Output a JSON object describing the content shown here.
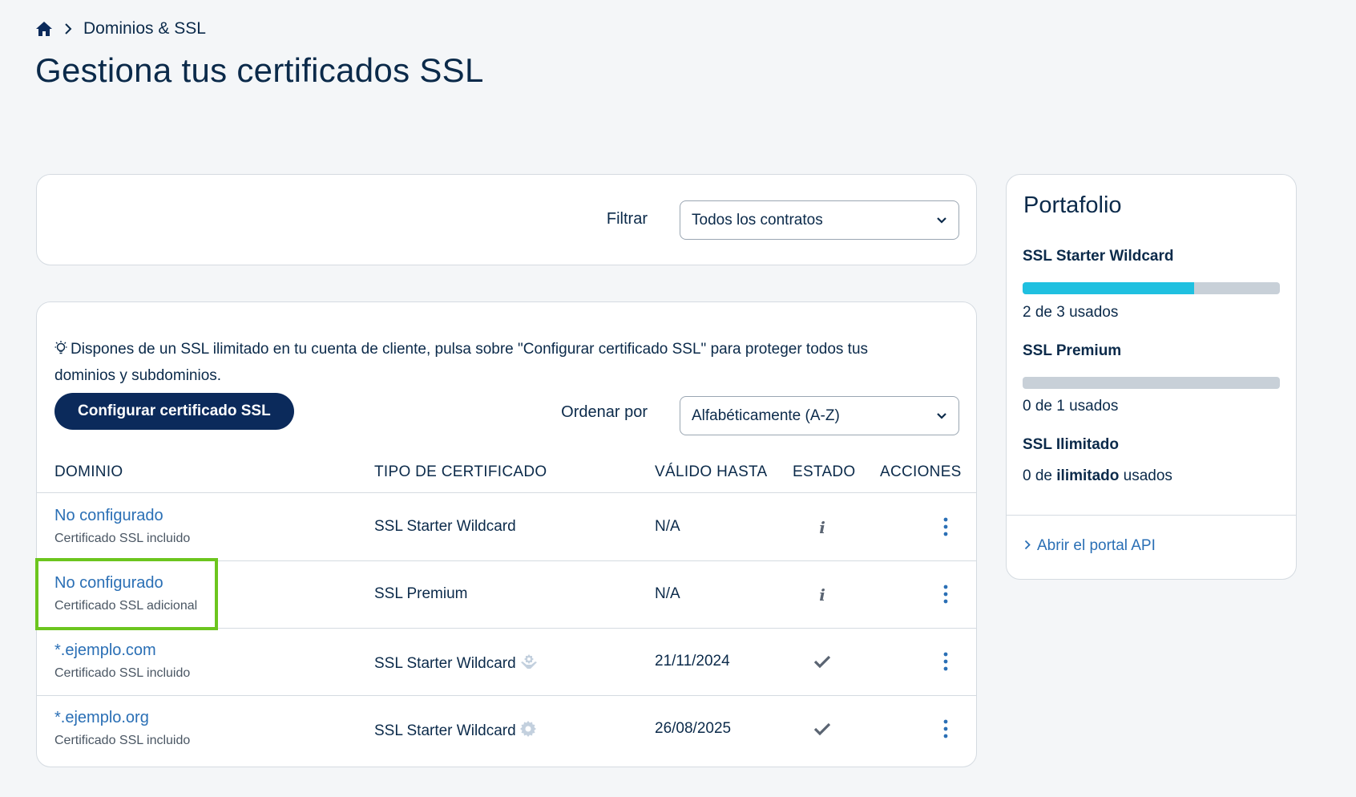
{
  "breadcrumb": {
    "current": "Dominios & SSL",
    "home_icon": "home-icon",
    "separator_icon": "chevron-right-icon"
  },
  "page": {
    "title": "Gestiona tus certificados SSL"
  },
  "filter": {
    "label": "Filtrar",
    "selected": "Todos los contratos"
  },
  "info": {
    "text": "Dispones de un SSL ilimitado en tu cuenta de cliente, pulsa sobre \"Configurar certificado SSL\" para proteger todos tus dominios y subdominios."
  },
  "configure_button": {
    "label": "Configurar certificado SSL"
  },
  "sort": {
    "label": "Ordenar por",
    "selected": "Alfabéticamente (A-Z)"
  },
  "table": {
    "headers": {
      "domain": "DOMINIO",
      "type": "TIPO DE CERTIFICADO",
      "valid": "VÁLIDO HASTA",
      "state": "ESTADO",
      "actions": "ACCIONES"
    },
    "rows": [
      {
        "domain": "No configurado",
        "sub": "Certificado SSL incluido",
        "type": "SSL Starter Wildcard",
        "type_icon": "",
        "valid": "N/A",
        "state_icon": "info-icon"
      },
      {
        "domain": "No configurado",
        "sub": "Certificado SSL adicional",
        "type": "SSL Premium",
        "type_icon": "",
        "valid": "N/A",
        "state_icon": "info-icon"
      },
      {
        "domain": "*.ejemplo.com",
        "sub": "Certificado SSL incluido",
        "type": "SSL Starter Wildcard",
        "type_icon": "managed-hands-icon",
        "valid": "21/11/2024",
        "state_icon": "check-icon"
      },
      {
        "domain": "*.ejemplo.org",
        "sub": "Certificado SSL incluido",
        "type": "SSL Starter Wildcard",
        "type_icon": "gear-icon",
        "valid": "26/08/2025",
        "state_icon": "check-icon"
      }
    ]
  },
  "portfolio": {
    "title": "Portafolio",
    "items": [
      {
        "name": "SSL Starter Wildcard",
        "usage": "2 de 3 usados",
        "used": 2,
        "total": 3
      },
      {
        "name": "SSL Premium",
        "usage": "0 de 1 usados",
        "used": 0,
        "total": 1
      },
      {
        "name": "SSL Ilimitado",
        "usage_pre": "0 de ",
        "usage_bold": "ilimitado",
        "usage_post": " usados"
      }
    ],
    "api_link": "Abrir el portal API"
  },
  "colors": {
    "primary": "#0b2a5b",
    "link": "#2a6fb5",
    "progress": "#1fc0e0",
    "highlight": "#6cc51e"
  }
}
